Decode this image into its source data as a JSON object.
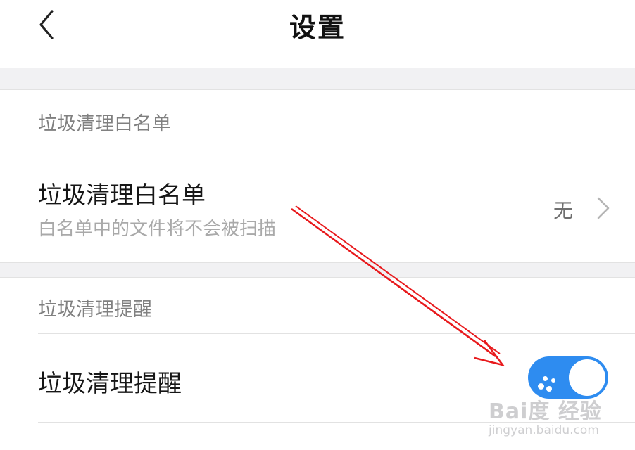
{
  "header": {
    "title": "设置",
    "back_icon": "chevron-left-icon"
  },
  "sections": [
    {
      "header": "垃圾清理白名单",
      "row": {
        "title": "垃圾清理白名单",
        "subtitle": "白名单中的文件将不会被扫描",
        "value": "无",
        "chevron_icon": "chevron-right-icon"
      }
    },
    {
      "header": "垃圾清理提醒",
      "row": {
        "title": "垃圾清理提醒",
        "toggle_on": true,
        "toggle_color": "#2e8cf0"
      }
    }
  ],
  "annotation": {
    "arrow_color": "#e8191c"
  },
  "watermark": {
    "logo": "Bai度 经验",
    "url": "jingyan.baidu.com"
  }
}
